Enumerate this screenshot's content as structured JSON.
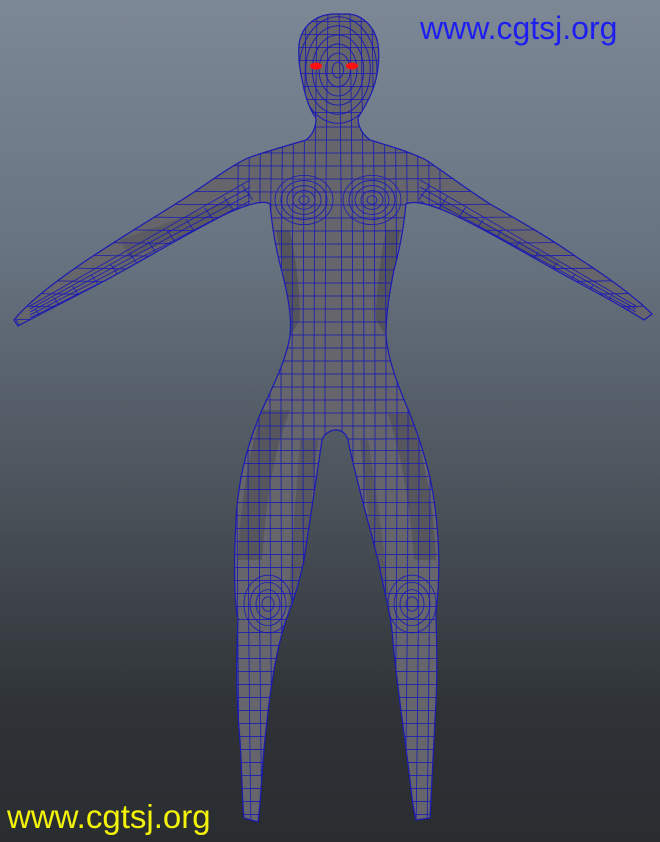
{
  "viewport": {
    "background_top": "#7d8896",
    "background_bottom": "#2a2d30"
  },
  "model": {
    "mesh_fill": "#65656b",
    "mesh_shadow": "#4a4a50",
    "wire_color": "#1a1ab4",
    "eye_color": "#ff1010"
  },
  "watermarks": {
    "top": {
      "text": "www.cgtsj.org",
      "color": "#1e1ef0"
    },
    "bottom": {
      "text": "www.cgtsj.org",
      "color": "#f2f20a"
    }
  }
}
